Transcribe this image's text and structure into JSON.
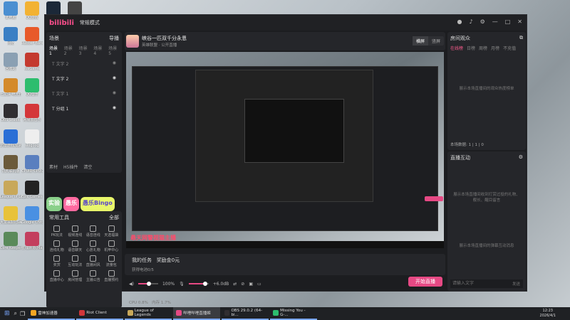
{
  "desktop": {
    "icons": [
      {
        "label": "此电脑",
        "color": "#4b8fd1"
      },
      {
        "label": "QQ游戏",
        "color": "#f2b233"
      },
      {
        "label": "Steam",
        "color": "#1b2838"
      },
      {
        "label": "G HUB",
        "color": "#444"
      },
      {
        "label": "",
        "color": "#e07cb6"
      },
      {
        "label": "",
        "color": "#5b7f9a"
      },
      {
        "label": "网络",
        "color": "#3a7fc4"
      },
      {
        "label": "Rubber Bandits",
        "color": "#e85a2a"
      },
      {
        "label": "回收站",
        "color": "#8aa0b3"
      },
      {
        "label": "WeGame",
        "color": "#c43a2f"
      },
      {
        "label": "七龙珠 电光作裂！ZERO",
        "color": "#d48a2b"
      },
      {
        "label": "QQ音乐",
        "color": "#2dbd6e"
      },
      {
        "label": "OBS Studio",
        "color": "#302e31"
      },
      {
        "label": "网易云音乐",
        "color": "#d4373a"
      },
      {
        "label": "迅雷游戏加速器",
        "color": "#2a6fd6"
      },
      {
        "label": "slog.log",
        "color": "#eee"
      },
      {
        "label": "饥荒联机版",
        "color": "#6b5a3a"
      },
      {
        "label": "CPUID CPU-Z",
        "color": "#5a7fbf"
      },
      {
        "label": "League of Legends",
        "color": "#c8a85a"
      },
      {
        "label": "Epic Games Launcher",
        "color": "#222"
      },
      {
        "label": "大富翁10(Switch...)",
        "color": "#e8c23a"
      },
      {
        "label": "Google Chrome",
        "color": "#4a90e2"
      },
      {
        "label": "Core Keeper 激活...",
        "color": "#5a8a5a"
      },
      {
        "label": "雀魂麻将(Mahjong...)",
        "color": "#c33f5e"
      }
    ]
  },
  "app": {
    "logo": "bilibili",
    "mode": "常规模式",
    "scenes": {
      "title": "场景",
      "guide": "导播",
      "tabs": [
        "场景1",
        "场景2",
        "场景3",
        "场景4",
        "场景5"
      ],
      "items": [
        {
          "name": "文字 2",
          "active": false
        },
        {
          "name": "文字 2",
          "active": true
        },
        {
          "name": "文字 1",
          "active": false
        },
        {
          "name": "分组 1",
          "active": true
        }
      ],
      "footer": [
        "素材",
        "H5插件",
        "清空"
      ]
    },
    "banner": [
      "实验",
      "愚乐",
      "愚乐Bingo"
    ],
    "tools": {
      "title": "常用工具",
      "all": "全部",
      "items": [
        "PK玩法",
        "视频连线",
        "语音连线",
        "天选福袋",
        "连线礼物",
        "语音聊天",
        "心愿礼物",
        "机甲中心",
        "奖赏",
        "互动玩法",
        "直播间风",
        "流量包",
        "直播中心",
        "房间管理",
        "主播公告",
        "直播预约"
      ]
    },
    "stream": {
      "title": "峡谷一匹双千分永恩",
      "category": "英雄联盟",
      "room": "公开直播",
      "quality": [
        "横屏",
        "竖屏"
      ],
      "overlay_text": "悬天网警视猫主播"
    },
    "task": {
      "title": "我的任务",
      "status": "获得电池0/5",
      "reward": "奖励金0元"
    },
    "controls": {
      "volume": "100%",
      "mic": "+6.0dB",
      "start": "开始直播"
    },
    "status": {
      "cpu": "CPU 0.8%",
      "mem": "内存 1.7%"
    },
    "audience": {
      "title": "房间观众",
      "tabs": [
        "在线榜",
        "日榜",
        "周榜",
        "月榜",
        "不充值"
      ],
      "empty": "展示本场直播间的观众热度榜单",
      "stats": "本场数据",
      "stat_values": [
        "1",
        "1",
        "0"
      ]
    },
    "interaction": {
      "title": "直播互动",
      "empty1": "展示本场直播间收到打赏过投的礼物、舰长、醒目留言",
      "empty2": "展示本场直播间的弹幕互动消息",
      "input_placeholder": "请输入文字",
      "send": "发送"
    }
  },
  "taskbar": {
    "items": [
      {
        "label": "雷神加速器",
        "color": "#f5a623"
      },
      {
        "label": "Riot Client",
        "color": "#d13639"
      },
      {
        "label": "League of Legends",
        "color": "#c8a85a"
      },
      {
        "label": "哔哩哔哩直播姬",
        "color": "#e64984"
      },
      {
        "label": "OBS 29.0.2 (64-bi...",
        "color": "#302e31"
      },
      {
        "label": "Missing You - G-...",
        "color": "#2dbd6e"
      }
    ],
    "time": "12:23",
    "date": "2026/4/1"
  }
}
